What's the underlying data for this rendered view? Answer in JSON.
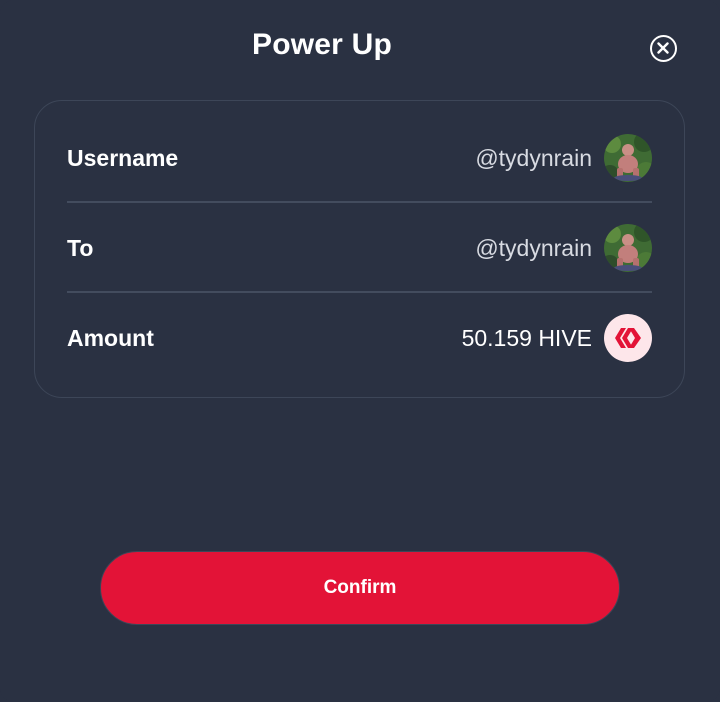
{
  "modal": {
    "title": "Power Up",
    "close_icon": "close-icon"
  },
  "details": {
    "rows": [
      {
        "label": "Username",
        "value": "@tydynrain",
        "icon": "user-avatar"
      },
      {
        "label": "To",
        "value": "@tydynrain",
        "icon": "user-avatar"
      },
      {
        "label": "Amount",
        "value": "50.159 HIVE",
        "icon": "hive-logo-icon"
      }
    ]
  },
  "actions": {
    "confirm_label": "Confirm"
  },
  "colors": {
    "background": "#2a3142",
    "accent": "#e31337",
    "border": "#3d4658",
    "hive_logo_bg": "#fde6ea"
  }
}
